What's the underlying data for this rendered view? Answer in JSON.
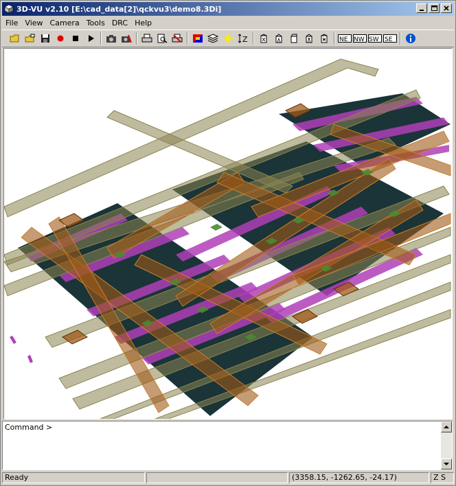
{
  "window": {
    "title": "3D-VU v2.10 [E:\\cad_data[2]\\qckvu3\\demo8.3Di]"
  },
  "menu": [
    "File",
    "View",
    "Camera",
    "Tools",
    "DRC",
    "Help"
  ],
  "toolbar": {
    "groups": [
      [
        "open-folder-icon",
        "open-project-icon",
        "save-icon",
        "record-icon",
        "stop-icon",
        "play-icon"
      ],
      [
        "camera-icon",
        "camera-settings-icon"
      ],
      [
        "print-icon",
        "print-preview-icon",
        "print-setup-icon"
      ],
      [
        "color-palette-icon",
        "layers-icon",
        "light-icon",
        "z-scale-icon"
      ],
      [
        "view-1-icon",
        "view-2-icon",
        "view-3-icon",
        "view-4-icon",
        "view-5-icon"
      ],
      [
        "ne-view-icon",
        "nw-view-icon",
        "sw-view-icon",
        "se-view-icon"
      ],
      [
        "info-icon"
      ]
    ],
    "labels": {
      "ne": "NE",
      "nw": "NW",
      "sw": "SW",
      "se": "SE",
      "z": "Z"
    }
  },
  "command": {
    "label": "Command >"
  },
  "status": {
    "state": "Ready",
    "coords": "(3358.15, -1262.65, -24.17)",
    "mode": "Z S"
  },
  "colors": {
    "titlebar_start": "#0a246a",
    "substrate": "#1a3438",
    "metal_magenta": "#b040b8",
    "poly_olive": "#8a8450",
    "metal_orange": "#a05a18",
    "via_green": "#4a8a30"
  }
}
